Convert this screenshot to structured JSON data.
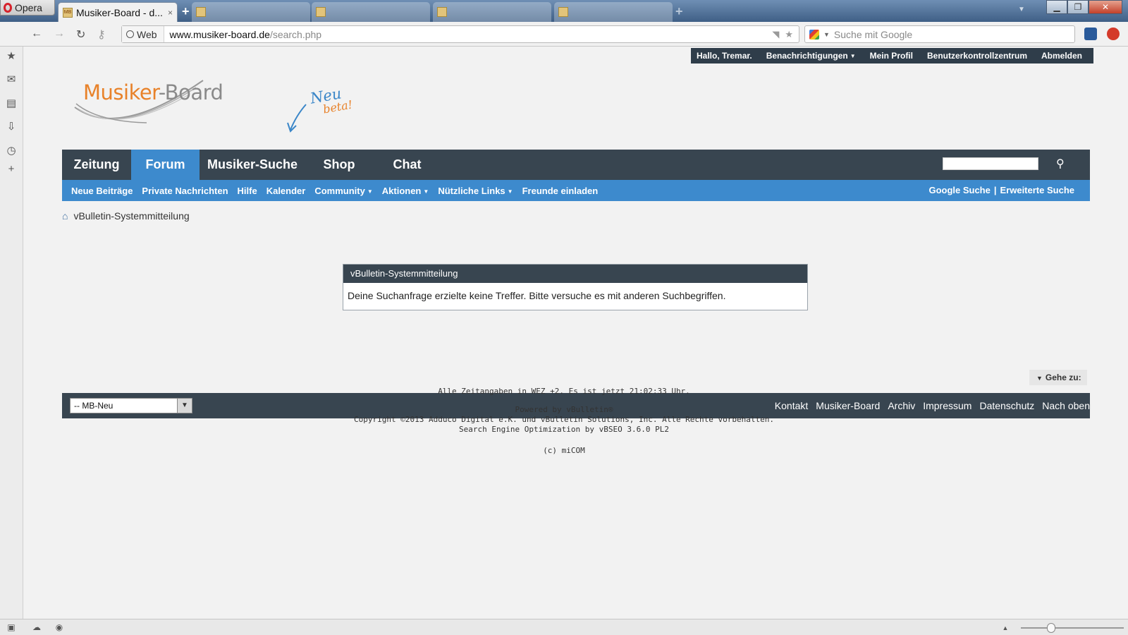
{
  "browser": {
    "menu_label": "Opera",
    "active_tab": {
      "favicon_text": "MB",
      "title": "Musiker-Board - d...",
      "close": "×"
    },
    "inactive_tabs": [
      "",
      "",
      "",
      ""
    ],
    "new_tab_label": "+",
    "address": {
      "mode_label": "Web",
      "url_domain": "www.musiker-board.de",
      "url_path": "/search.php"
    },
    "search_placeholder": "Suche mit Google"
  },
  "site": {
    "userbar": {
      "greeting": "Hallo, Tremar.",
      "notifications": "Benachrichtigungen",
      "profile": "Mein Profil",
      "usercp": "Benutzerkontrollzentrum",
      "logout": "Abmelden"
    },
    "logo": {
      "part1": "Musiker",
      "part2": "-Board"
    },
    "beta_badge": {
      "line1": "Neu",
      "line2": "beta!"
    },
    "main_nav": [
      "Zeitung",
      "Forum",
      "Musiker-Suche",
      "Shop",
      "Chat"
    ],
    "sub_nav": [
      {
        "label": "Neue Beiträge",
        "has_caret": false
      },
      {
        "label": "Private Nachrichten",
        "has_caret": false
      },
      {
        "label": "Hilfe",
        "has_caret": false
      },
      {
        "label": "Kalender",
        "has_caret": false
      },
      {
        "label": "Community",
        "has_caret": true
      },
      {
        "label": "Aktionen",
        "has_caret": true
      },
      {
        "label": "Nützliche Links",
        "has_caret": true
      },
      {
        "label": "Freunde einladen",
        "has_caret": false
      }
    ],
    "sub_nav_right": {
      "google": "Google Suche",
      "separator": "|",
      "advanced": "Erweiterte Suche"
    },
    "breadcrumb": "vBulletin-Systemmitteilung",
    "message": {
      "title": "vBulletin-Systemmitteilung",
      "body": "Deine Suchanfrage erzielte keine Treffer. Bitte versuche es mit anderen Suchbegriffen."
    },
    "goto_label": "Gehe zu:",
    "footer": {
      "forum_select": "-- MB-Neu",
      "links": [
        "Kontakt",
        "Musiker-Board",
        "Archiv",
        "Impressum",
        "Datenschutz",
        "Nach oben"
      ]
    },
    "credits": {
      "time": "Alle Zeitangaben in WEZ +2. Es ist jetzt 21:02:33 Uhr.",
      "powered": "Powered by vBulletin®",
      "copyright": "Copyright ©2013 Adduco Digital e.K. und vBulletin Solutions, Inc. Alle Rechte vorbehalten.",
      "seo": "Search Engine Optimization by vBSEO 3.6.0 PL2",
      "micom": "(c) miCOM"
    }
  },
  "colors": {
    "nav_dark": "#384550",
    "nav_blue": "#3d8acd",
    "brand_orange": "#e8822a"
  }
}
